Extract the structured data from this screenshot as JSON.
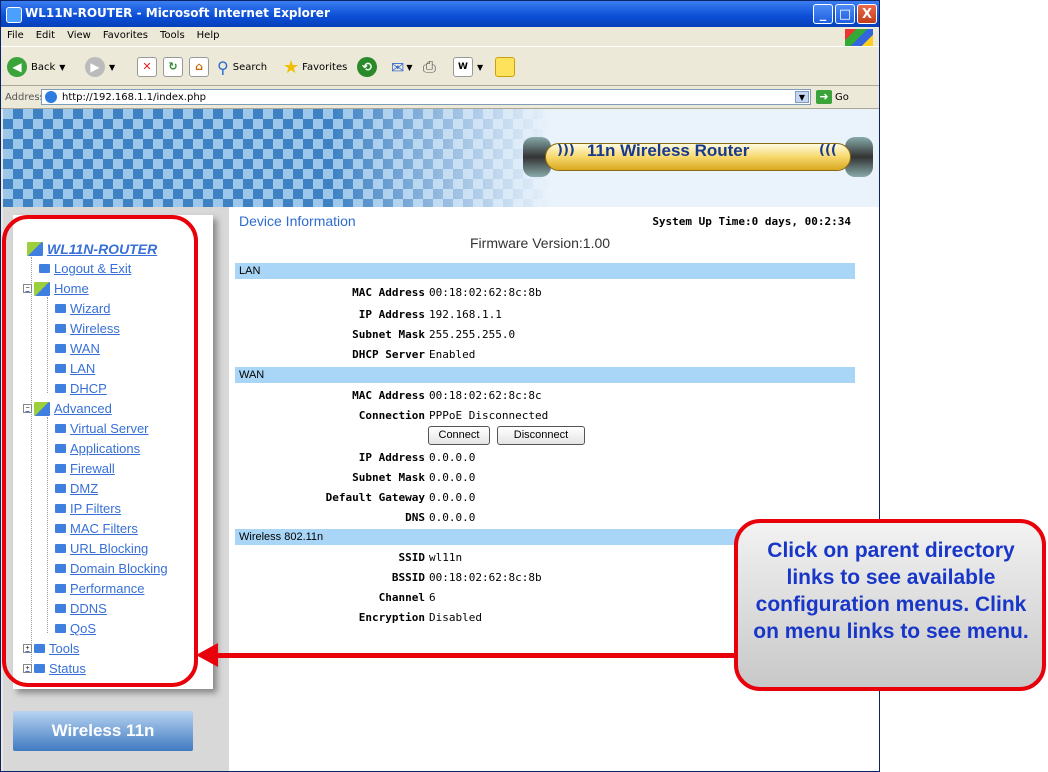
{
  "window": {
    "title": "WL11N-ROUTER - Microsoft Internet Explorer",
    "minimize": "_",
    "maximize": "□",
    "close": "X"
  },
  "menu": [
    "File",
    "Edit",
    "View",
    "Favorites",
    "Tools",
    "Help"
  ],
  "toolbar": {
    "back": "Back",
    "search": "Search",
    "favorites": "Favorites"
  },
  "address": {
    "label": "Address",
    "url": "http://192.168.1.1/index.php",
    "go": "Go"
  },
  "banner": {
    "title": "11n Wireless Router",
    "left_waves": ")))",
    "right_waves": "((("
  },
  "tree": {
    "root": "WL11N-ROUTER",
    "logout": "Logout & Exit",
    "home": "Home",
    "home_items": [
      "Wizard",
      "Wireless",
      "WAN",
      "LAN",
      "DHCP"
    ],
    "advanced": "Advanced",
    "advanced_items": [
      "Virtual Server",
      "Applications",
      "Firewall",
      "DMZ",
      "IP Filters",
      "MAC Filters",
      "URL Blocking",
      "Domain Blocking",
      "Performance",
      "DDNS",
      "QoS"
    ],
    "tools": "Tools",
    "status": "Status"
  },
  "logo_text": "Wireless 11n",
  "device": {
    "heading": "Device Information",
    "uptime": "System Up Time:0 days, 00:2:34",
    "firmware": "Firmware Version:1.00"
  },
  "lan": {
    "title": "LAN",
    "rows": [
      {
        "k": "MAC Address",
        "v": "00:18:02:62:8c:8b"
      },
      {
        "k": "IP Address",
        "v": "192.168.1.1"
      },
      {
        "k": "Subnet Mask",
        "v": "255.255.255.0"
      },
      {
        "k": "DHCP Server",
        "v": "Enabled"
      }
    ]
  },
  "wan": {
    "title": "WAN",
    "mac": {
      "k": "MAC Address",
      "v": "00:18:02:62:8c:8c"
    },
    "connection": {
      "k": "Connection",
      "v": "PPPoE Disconnected"
    },
    "connect_btn": "Connect",
    "disconnect_btn": "Disconnect",
    "rows": [
      {
        "k": "IP Address",
        "v": "0.0.0.0"
      },
      {
        "k": "Subnet Mask",
        "v": "0.0.0.0"
      },
      {
        "k": "Default Gateway",
        "v": "0.0.0.0"
      },
      {
        "k": "DNS",
        "v": "0.0.0.0"
      }
    ]
  },
  "wireless": {
    "title": "Wireless 802.11n",
    "rows": [
      {
        "k": "SSID",
        "v": "wl11n"
      },
      {
        "k": "BSSID",
        "v": "00:18:02:62:8c:8b"
      },
      {
        "k": "Channel",
        "v": "6"
      },
      {
        "k": "Encryption",
        "v": "Disabled"
      }
    ]
  },
  "callout": "Click on parent directory links to see available configuration menus. Clink on menu links to see menu.",
  "colors": {
    "annotation_red": "#e8000a",
    "callout_text": "#1836c8",
    "section_bg": "#a9d6f7",
    "link": "#3870d8"
  }
}
